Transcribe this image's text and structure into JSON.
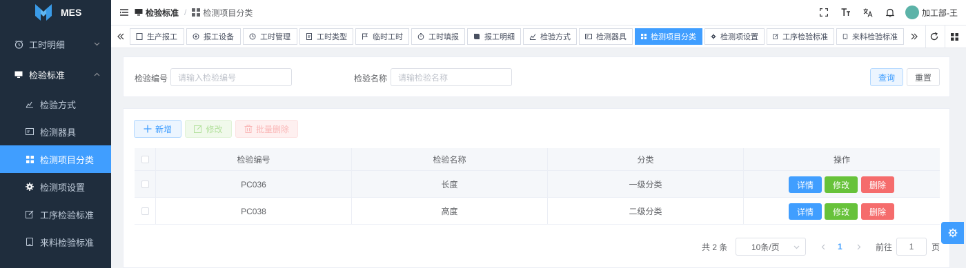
{
  "app": {
    "name": "MES"
  },
  "sidebar": {
    "groups": [
      {
        "label": "工时明细",
        "icon": "alarm-clock-icon",
        "expanded": false
      },
      {
        "label": "检验标准",
        "icon": "monitor-icon",
        "expanded": true
      }
    ],
    "items": [
      {
        "label": "检验方式",
        "icon": "chart-icon",
        "active": false
      },
      {
        "label": "检测器具",
        "icon": "card-icon",
        "active": false
      },
      {
        "label": "检测项目分类",
        "icon": "grid-icon",
        "active": true
      },
      {
        "label": "检测项设置",
        "icon": "gear-icon",
        "active": false
      },
      {
        "label": "工序检验标准",
        "icon": "edit-icon",
        "active": false
      },
      {
        "label": "来料检验标准",
        "icon": "phone-icon",
        "active": false
      }
    ]
  },
  "header": {
    "breadcrumb": [
      {
        "label": "检验标准",
        "icon": "monitor-icon"
      },
      {
        "label": "检测项目分类",
        "icon": "grid-icon"
      }
    ],
    "user": "加工部-王"
  },
  "tabs": [
    {
      "label": "生产报工",
      "icon": "doc-icon"
    },
    {
      "label": "报工设备",
      "icon": "target-icon"
    },
    {
      "label": "工时管理",
      "icon": "clock-icon"
    },
    {
      "label": "工时类型",
      "icon": "file-icon"
    },
    {
      "label": "临时工时",
      "icon": "flag-icon"
    },
    {
      "label": "工时填报",
      "icon": "timer-icon"
    },
    {
      "label": "报工明细",
      "icon": "book-icon"
    },
    {
      "label": "检验方式",
      "icon": "chart-icon"
    },
    {
      "label": "检测器具",
      "icon": "card-icon"
    },
    {
      "label": "检测项目分类",
      "icon": "grid-icon",
      "active": true
    },
    {
      "label": "检测项设置",
      "icon": "gear-icon"
    },
    {
      "label": "工序检验标准",
      "icon": "edit-icon"
    },
    {
      "label": "来料检验标准",
      "icon": "phone-icon"
    }
  ],
  "search": {
    "code_label": "检验编号",
    "code_placeholder": "请输入检验编号",
    "name_label": "检验名称",
    "name_placeholder": "请输检验名称",
    "query_button": "查询",
    "reset_button": "重置"
  },
  "toolbar": {
    "add_button": "新增",
    "edit_button": "修改",
    "batch_delete_button": "批量删除"
  },
  "table": {
    "columns": [
      "检验编号",
      "检验名称",
      "分类",
      "操作"
    ],
    "rows": [
      {
        "code": "PC036",
        "name": "长度",
        "category": "一级分类"
      },
      {
        "code": "PC038",
        "name": "高度",
        "category": "二级分类"
      }
    ],
    "actions": {
      "detail": "详情",
      "edit": "修改",
      "delete": "删除"
    }
  },
  "pagination": {
    "total_text": "共 2 条",
    "page_size": "10条/页",
    "current_page": "1",
    "goto_label": "前往",
    "goto_value": "1",
    "page_suffix": "页"
  },
  "colors": {
    "primary": "#409eff",
    "success": "#67c23a",
    "danger": "#f56c6c",
    "sidebar": "#1f2d3d"
  }
}
